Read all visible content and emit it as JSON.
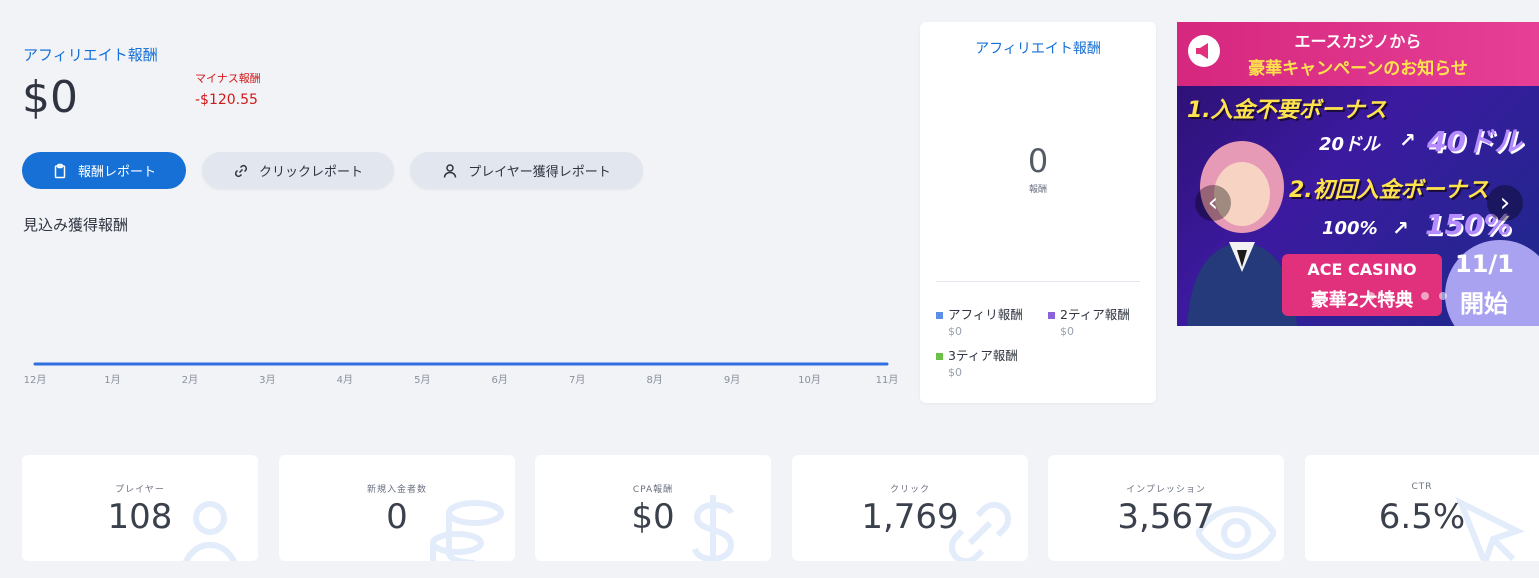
{
  "summary": {
    "title": "アフィリエイト報酬",
    "amount": "$0",
    "negative_label": "マイナス報酬",
    "negative_value": "-$120.55"
  },
  "tabs": [
    {
      "label": "報酬レポート",
      "icon": "clipboard-icon",
      "active": true
    },
    {
      "label": "クリックレポート",
      "icon": "link-icon",
      "active": false
    },
    {
      "label": "プレイヤー獲得レポート",
      "icon": "user-icon",
      "active": false
    }
  ],
  "chart_section_label": "見込み獲得報酬",
  "chart_data": {
    "type": "line",
    "categories": [
      "12月",
      "1月",
      "2月",
      "3月",
      "4月",
      "5月",
      "6月",
      "7月",
      "8月",
      "9月",
      "10月",
      "11月"
    ],
    "series": [
      {
        "values": [
          0,
          0,
          0,
          0,
          0,
          0,
          0,
          0,
          0,
          0,
          0,
          0
        ]
      }
    ],
    "title": "",
    "xlabel": "",
    "ylabel": "",
    "color": "#2f6fe0"
  },
  "breakdown_card": {
    "title": "アフィリエイト報酬",
    "center_value": "0",
    "center_label": "報酬",
    "legend": [
      {
        "label": "アフィリ報酬",
        "value": "$0",
        "color": "#5b8ee6"
      },
      {
        "label": "2ティア報酬",
        "value": "$0",
        "color": "#8a63d9"
      },
      {
        "label": "3ティア報酬",
        "value": "$0",
        "color": "#6cc04a"
      }
    ]
  },
  "banner": {
    "line1": "エースカジノから",
    "line2": "豪華キャンペーンのお知らせ",
    "promo1_head": "1.入金不要ボーナス",
    "promo1_from": "20ドル",
    "promo1_to": "40ドル",
    "promo2_head": "2.初回入金ボーナス",
    "promo2_from": "100%",
    "promo2_to": "150%",
    "casino_name": "ACE CASINO",
    "casino_sub": "豪華2大特典",
    "date": "11/1",
    "date_suffix": "開始",
    "prev_icon": "chevron-left-icon",
    "next_icon": "chevron-right-icon"
  },
  "stats": [
    {
      "label": "プレイヤー",
      "value": "108",
      "icon": "user-icon"
    },
    {
      "label": "新規入金者数",
      "value": "0",
      "icon": "coins-icon"
    },
    {
      "label": "CPA報酬",
      "value": "$0",
      "icon": "dollar-icon"
    },
    {
      "label": "クリック",
      "value": "1,769",
      "icon": "link-icon"
    },
    {
      "label": "インプレッション",
      "value": "3,567",
      "icon": "eye-icon"
    },
    {
      "label": "CTR",
      "value": "6.5%",
      "icon": "cursor-icon"
    }
  ]
}
